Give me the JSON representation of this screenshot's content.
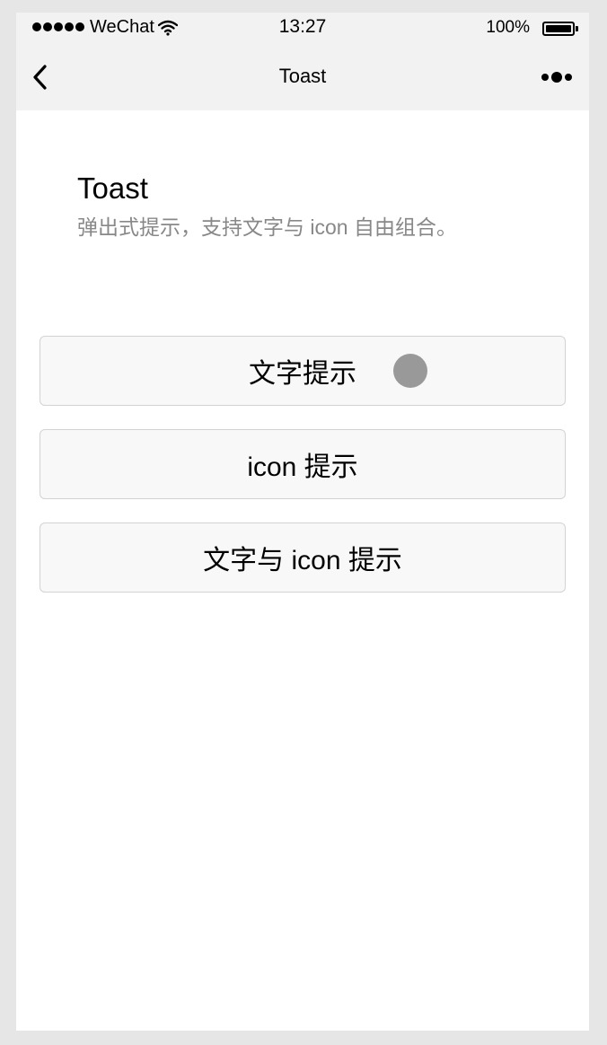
{
  "status_bar": {
    "carrier": "WeChat",
    "time": "13:27",
    "battery_percent": "100%",
    "signal_bars": 5,
    "icons": [
      "signal-dots-icon",
      "wifi-icon",
      "battery-icon"
    ]
  },
  "nav_bar": {
    "title": "Toast",
    "icons": [
      "back-chevron-icon",
      "more-dots-icon"
    ]
  },
  "page": {
    "title": "Toast",
    "description": "弹出式提示，支持文字与 icon 自由组合。"
  },
  "buttons": [
    {
      "label": "文字提示"
    },
    {
      "label": "icon 提示"
    },
    {
      "label": "文字与 icon 提示"
    }
  ],
  "colors": {
    "bar_background": "#f2f2f2",
    "button_background": "#f8f8f8",
    "button_border": "#d3d3d3",
    "description_text": "#888888",
    "touch_indicator": "#999999"
  }
}
